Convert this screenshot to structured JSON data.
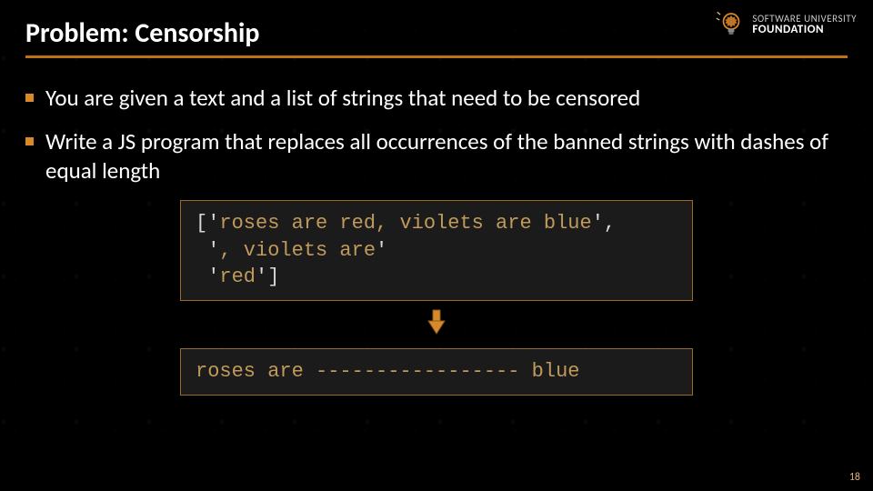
{
  "logo": {
    "line1": "SOFTWARE UNIVERSITY",
    "line2": "FOUNDATION",
    "icon": "lightbulb-gear-icon"
  },
  "title": "Problem: Censorship",
  "bullets": [
    "You are given a text and a list of strings that need to be censored",
    "Write a JS program that replaces all occurrences of the banned strings with dashes of equal length"
  ],
  "code": {
    "line1_open": "['",
    "line1_str": "roses are red, violets are blue",
    "line1_close": "',",
    "line2_open": " '",
    "line2_str": ", violets are",
    "line2_close": "'",
    "line3_open": " '",
    "line3_str": "red",
    "line3_close": "']"
  },
  "output": "roses are ----------------- blue",
  "page_number": "18"
}
